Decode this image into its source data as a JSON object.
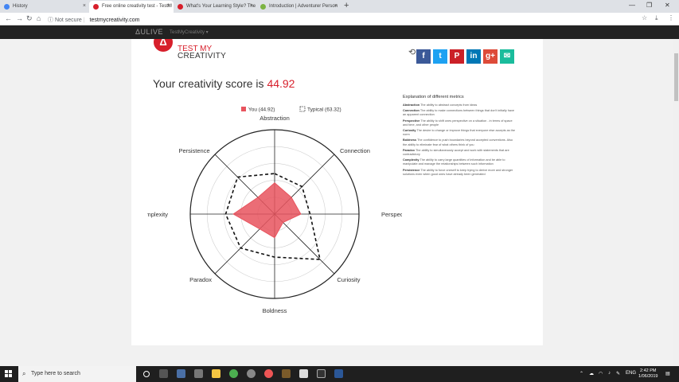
{
  "browser": {
    "tabs": [
      {
        "title": "History",
        "color": "#4285f4",
        "x": 0,
        "w": 112
      },
      {
        "title": "Free online creativity test - TestM",
        "color": "#d71f2b",
        "x": 112,
        "w": 106,
        "active": true
      },
      {
        "title": "What's Your Learning Style? The",
        "color": "#d71f2b",
        "x": 218,
        "w": 104
      },
      {
        "title": "Introduction | Adventurer Person",
        "color": "#7cb342",
        "x": 322,
        "w": 106
      }
    ],
    "tab_close": "×",
    "new_tab": "+",
    "security_label": "Not secure",
    "url": "testmycreativity.com"
  },
  "site": {
    "brand": "ΔULIVE",
    "brand_sub": "TestMyCreativity ▾",
    "logo_line1": "TEST MY",
    "logo_line2": "CREATIVITY",
    "score_prefix": "Your creativity score is ",
    "score_value": "44.92"
  },
  "social": [
    {
      "icon": "facebook-icon",
      "glyph": "f",
      "color": "#3b5998"
    },
    {
      "icon": "twitter-icon",
      "glyph": "t",
      "color": "#1da1f2"
    },
    {
      "icon": "pinterest-icon",
      "glyph": "P",
      "color": "#cb2027"
    },
    {
      "icon": "linkedin-icon",
      "glyph": "in",
      "color": "#0077b5"
    },
    {
      "icon": "googleplus-icon",
      "glyph": "g+",
      "color": "#dd4b39"
    },
    {
      "icon": "email-icon",
      "glyph": "✉",
      "color": "#1abc9c"
    }
  ],
  "chart_data": {
    "type": "radar",
    "axes": [
      "Abstraction",
      "Connection",
      "Perspective",
      "Curiosity",
      "Boldness",
      "Paradox",
      "Complexity",
      "Persistence"
    ],
    "rmax": 100,
    "rings": 5,
    "series": [
      {
        "name": "You (44.92)",
        "values": [
          37,
          28,
          31,
          14,
          28,
          25,
          49,
          28
        ],
        "color": "#e8545e",
        "style": "filled"
      },
      {
        "name": "Typical (63.32)",
        "values": [
          48,
          46,
          42,
          76,
          51,
          57,
          58,
          62
        ],
        "color": "#111111",
        "style": "dashed"
      }
    ],
    "legend": "top"
  },
  "explanation": {
    "title": "Explanation of different metrics",
    "metrics": [
      {
        "name": "Abstraction",
        "desc": "The ability to abstract concepts from ideas"
      },
      {
        "name": "Connection",
        "desc": "The ability to make connections between things that don't initially have an apparent connection"
      },
      {
        "name": "Perspective",
        "desc": "The ability to shift ones perspective on a situation - in terms of space and time, and other people"
      },
      {
        "name": "Curiosity",
        "desc": "The desire to change or improve things that everyone else accepts as the norm"
      },
      {
        "name": "Boldness",
        "desc": "The confidence to push boundaries beyond accepted conventions. Also the ability to eliminate fear of what others think of you"
      },
      {
        "name": "Paradox",
        "desc": "The ability to simultaneously accept and work with statements that are contradictory"
      },
      {
        "name": "Complexity",
        "desc": "The ability to carry large quantities of information and be able to manipulate and manage the relationships between such information"
      },
      {
        "name": "Persistence",
        "desc": "The ability to force oneself to keep trying to derive more and stronger solutions even when good ones have already been generated"
      }
    ]
  },
  "taskbar": {
    "search_placeholder": "Type here to search",
    "language": "ENG",
    "time": "2:42 PM",
    "date": "1/06/2019"
  }
}
